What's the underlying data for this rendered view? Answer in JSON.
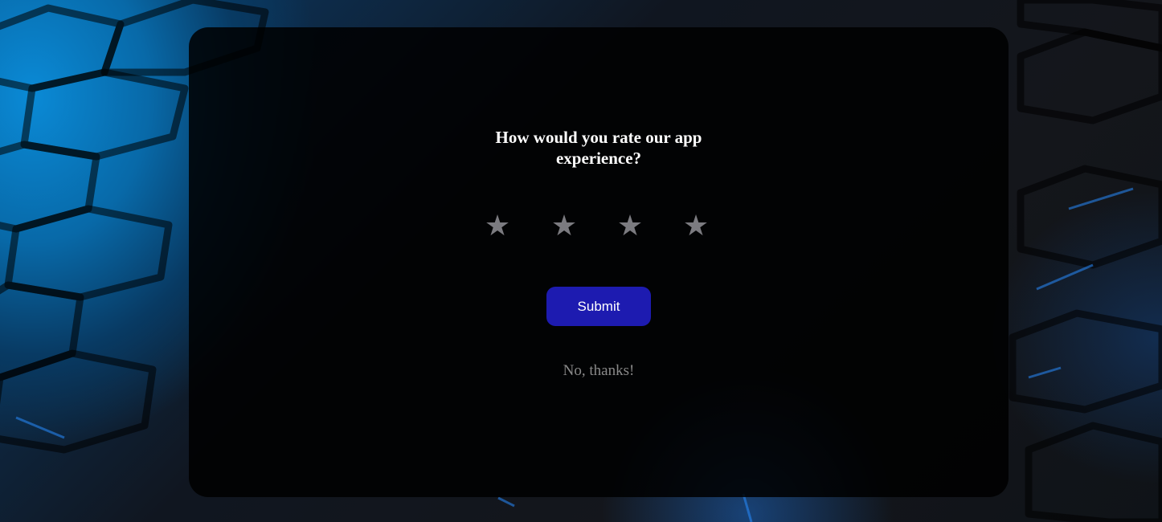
{
  "survey": {
    "question": "How would you rate our app experience?",
    "rating": {
      "value": 0,
      "max": 4,
      "star_glyph": "★",
      "empty_color": "#7b7b80"
    },
    "submit_label": "Submit",
    "decline_label": "No, thanks!"
  },
  "colors": {
    "card_background": "#000000",
    "submit_button": "#1d1bb0",
    "question_text": "#ffffff",
    "decline_text": "#8a8a8a",
    "background_accent": "#0a8ad6"
  }
}
